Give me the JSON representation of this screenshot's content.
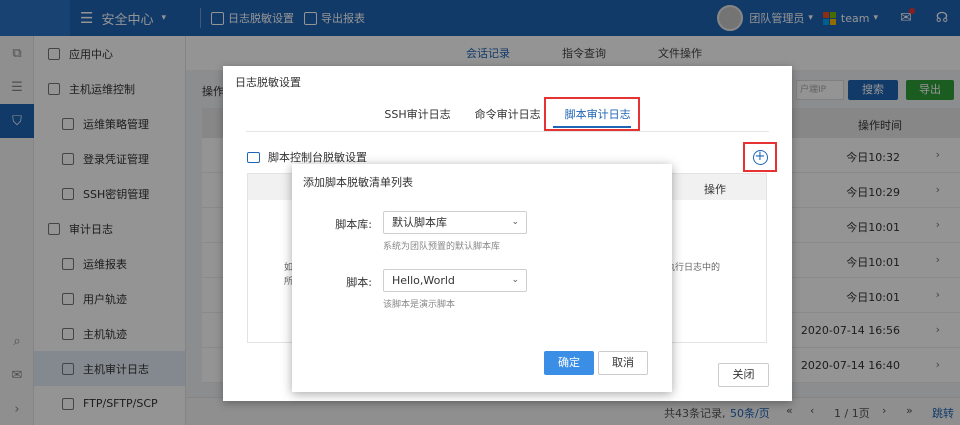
{
  "header": {
    "app_title": "安全中心",
    "actions": [
      "日志脱敏设置",
      "导出报表"
    ],
    "user_name": "团队管理员",
    "team_name": "team"
  },
  "sidebar": {
    "items": [
      {
        "label": "应用中心",
        "sub": false
      },
      {
        "label": "主机运维控制",
        "sub": false
      },
      {
        "label": "运维策略管理",
        "sub": true
      },
      {
        "label": "登录凭证管理",
        "sub": true
      },
      {
        "label": "SSH密钥管理",
        "sub": true
      },
      {
        "label": "审计日志",
        "sub": false
      },
      {
        "label": "运维报表",
        "sub": true
      },
      {
        "label": "用户轨迹",
        "sub": true
      },
      {
        "label": "主机轨迹",
        "sub": true
      },
      {
        "label": "主机审计日志",
        "sub": true,
        "active": true
      },
      {
        "label": "FTP/SFTP/SCP",
        "sub": true
      }
    ]
  },
  "main": {
    "tabs": [
      "会话记录",
      "指令查询",
      "文件操作"
    ],
    "op_label": "操作",
    "search_placeholder": "户端IP",
    "search_label": "搜索",
    "export_label": "导出",
    "time_header": "操作时间",
    "rows": [
      "今日10:32",
      "今日10:29",
      "今日10:01",
      "今日10:01",
      "今日10:01",
      "2020-07-14 16:56",
      "2020-07-14 16:40"
    ],
    "footer": {
      "total": "共43条记录,",
      "per_page": "50条/页",
      "page": "1 / 1页",
      "jump": "跳转"
    }
  },
  "dialog_desensitize": {
    "title": "日志脱敏设置",
    "tabs": [
      "SSH审计日志",
      "命令审计日志",
      "脚本审计日志"
    ],
    "active_tab": "脚本审计日志",
    "section_title": "脚本控制台脱敏设置",
    "table_op_header": "操作",
    "desc_left": "如",
    "desc_left2": "所",
    "desc_right": "执行日志中的",
    "close_label": "关闭"
  },
  "dialog_add": {
    "title": "添加脚本脱敏清单列表",
    "library_label": "脚本库:",
    "library_value": "默认脚本库",
    "library_hint": "系统为团队预置的默认脚本库",
    "script_label": "脚本:",
    "script_value": "Hello,World",
    "script_hint": "该脚本是演示脚本",
    "ok_label": "确定",
    "cancel_label": "取消"
  },
  "colors": {
    "brand": "#1f65b6",
    "highlight": "#e53333",
    "primary_button": "#3a8ee6",
    "export_green": "#2fa03a"
  }
}
